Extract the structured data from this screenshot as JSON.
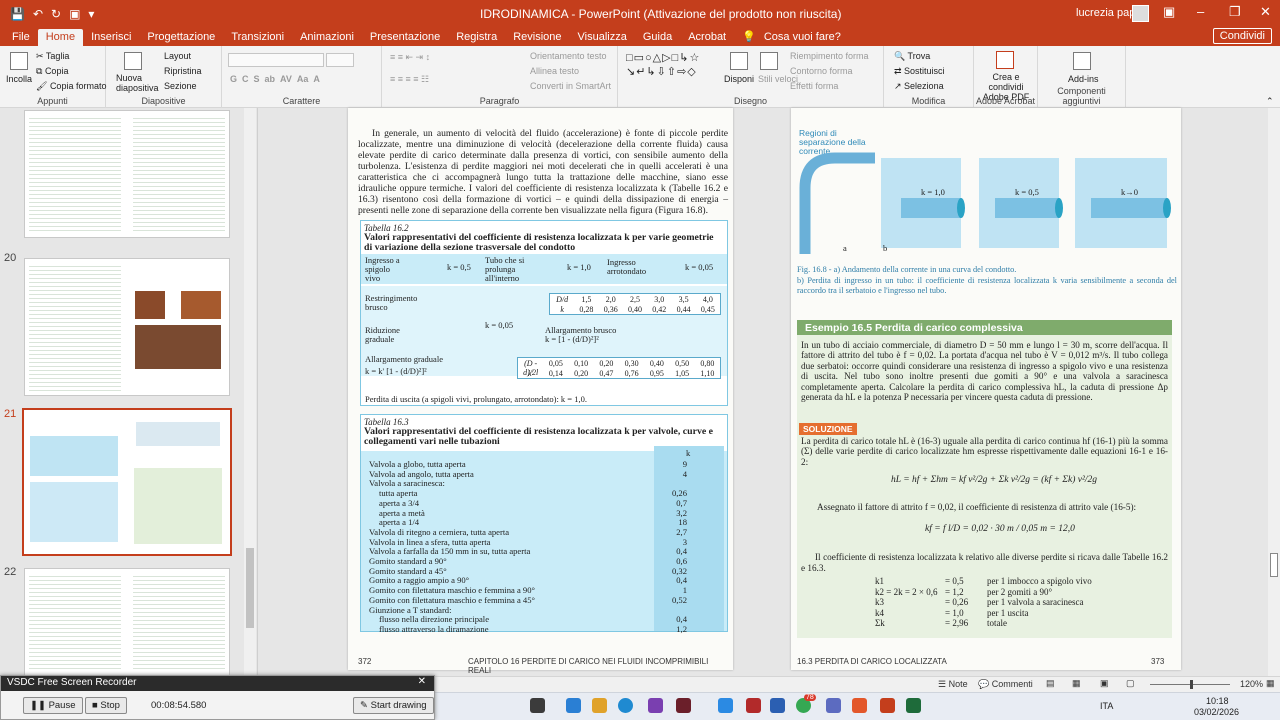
{
  "titlebar": {
    "title": "IDRODINAMICA  -  PowerPoint (Attivazione del prodotto non riuscita)",
    "user": "lucrezia papini"
  },
  "menu": {
    "tabs": [
      "File",
      "Home",
      "Inserisci",
      "Progettazione",
      "Transizioni",
      "Animazioni",
      "Presentazione",
      "Registra",
      "Revisione",
      "Visualizza",
      "Guida",
      "Acrobat"
    ],
    "active": "Home",
    "tell": "Cosa vuoi fare?",
    "share": "Condividi"
  },
  "ribbon": {
    "appunti": {
      "paste": "Incolla",
      "cut": "Taglia",
      "copy": "Copia",
      "format": "Copia formato",
      "label": "Appunti"
    },
    "diapositive": {
      "new": "Nuova diapositiva",
      "layout": "Layout",
      "reset": "Ripristina",
      "section": "Sezione",
      "label": "Diapositive"
    },
    "carattere": {
      "label": "Carattere"
    },
    "paragrafo": {
      "direction": "Orientamento testo",
      "align": "Allinea testo",
      "smartart": "Converti in SmartArt",
      "label": "Paragrafo"
    },
    "disegno": {
      "arrange": "Disponi",
      "quick": "Stili veloci",
      "fill": "Riempimento forma",
      "outline": "Contorno forma",
      "effects": "Effetti forma",
      "label": "Disegno"
    },
    "modifica": {
      "find": "Trova",
      "replace": "Sostituisci",
      "select": "Seleziona",
      "label": "Modifica"
    },
    "acrobat": {
      "create": "Crea e condividi Adobe PDF",
      "label": "Adobe Acrobat"
    },
    "addins": {
      "btn": "Add-ins",
      "label": "Componenti aggiuntivi"
    }
  },
  "slides": {
    "numbers": [
      "20",
      "21",
      "22"
    ],
    "selected": "21"
  },
  "left_page": {
    "para": "In generale, un aumento di velocità del fluido (accelerazione) è fonte di piccole perdite localizzate, mentre una diminuzione di velocità (decelerazione della corrente fluida) causa elevate perdite di carico determinate dalla presenza di vortici, con sensibile aumento della turbolenza. L'esistenza di perdite maggiori nei moti decelerati che in quelli accelerati è una caratteristica che ci accompagnerà lungo tutta la trattazione delle macchine, siano esse idrauliche oppure termiche. I valori del coefficiente di resistenza localizzata k (Tabelle 16.2 e 16.3) risentono così della formazione di vortici – e quindi della dissipazione di energia – presenti nelle zone di separazione della corrente ben visualizzate nella figura (Figura 16.8).",
    "t162": {
      "cap": "Tabella 16.2",
      "title": "Valori rappresentativi del coefficiente di resistenza localizzata k per varie geometrie di variazione della sezione trasversale del condotto",
      "c1": "Ingresso a spigolo vivo",
      "k1": "k = 0,5",
      "c2": "Tubo che si prolunga all'interno",
      "k2": "k = 1,0",
      "c3": "Ingresso arrotondato",
      "k3": "k = 0,05",
      "c4": "Restringimento brusco",
      "c5": "Riduzione graduale",
      "k5": "k = 0,05",
      "c6": "Allargamento brusco",
      "k6": "k = [1 - (d/D)²]²",
      "c7": "Allargamento graduale",
      "k7": "k = k' [1 - (d/D)²]²",
      "dd_head": "D/d",
      "dd_vals": [
        "1,5",
        "2,0",
        "2,5",
        "3,0",
        "3,5",
        "4,0"
      ],
      "dk_head": "k",
      "dk_vals": [
        "0,28",
        "0,36",
        "0,40",
        "0,42",
        "0,44",
        "0,45"
      ],
      "ang_head": "(D - d)/2l",
      "ang_vals": [
        "0,05",
        "0,10",
        "0,20",
        "0,30",
        "0,40",
        "0,50",
        "0,80"
      ],
      "kp_head": "k'",
      "kp_vals": [
        "0,14",
        "0,20",
        "0,47",
        "0,76",
        "0,95",
        "1,05",
        "1,10"
      ],
      "foot": "Perdita di uscita (a spigoli vivi, prolungato, arrotondato): k = 1,0."
    },
    "t163": {
      "cap": "Tabella 16.3",
      "title": "Valori rappresentativi del coefficiente di resistenza localizzata k per valvole, curve e collegamenti vari nelle tubazioni",
      "khead": "k",
      "rows": [
        [
          "Valvola a globo, tutta aperta",
          "9"
        ],
        [
          "Valvola ad angolo, tutta aperta",
          "4"
        ],
        [
          "Valvola a saracinesca:",
          ""
        ],
        [
          "  tutta aperta",
          "0,26"
        ],
        [
          "  aperta a 3/4",
          "0,7"
        ],
        [
          "  aperta a metà",
          "3,2"
        ],
        [
          "  aperta a 1/4",
          "18"
        ],
        [
          "Valvola di ritegno a cerniera, tutta aperta",
          "2,7"
        ],
        [
          "Valvola in linea a sfera, tutta aperta",
          "3"
        ],
        [
          "Valvola a farfalla da 150 mm in su, tutta aperta",
          "0,4"
        ],
        [
          "Gomito standard a 90°",
          "0,6"
        ],
        [
          "Gomito standard a 45°",
          "0,32"
        ],
        [
          "Gomito a raggio ampio a 90°",
          "0,4"
        ],
        [
          "Gomito con filettatura maschio e femmina a 90°",
          "1"
        ],
        [
          "Gomito con filettatura maschio e femmina a 45°",
          "0,52"
        ],
        [
          "Giunzione a T standard:",
          ""
        ],
        [
          "  flusso nella direzione principale",
          "0,4"
        ],
        [
          "  flusso attraverso la diramazione",
          "1,2"
        ]
      ]
    },
    "page_num": "372",
    "footer": "CAPITOLO 16   PERDITE DI CARICO NEI FLUIDI INCOMPRIMIBILI REALI"
  },
  "right_page": {
    "fig_label1": "Regioni di separazione della corrente",
    "fig_k": [
      "k = 1,0",
      "k = 0,5",
      "k→0"
    ],
    "fig_ab": [
      "a",
      "b"
    ],
    "fig_cap1": "Fig. 16.8 - a) Andamento della corrente in una curva del condotto.",
    "fig_cap2": "b) Perdita di ingresso in un tubo: il coefficiente di resistenza localizzata k varia sensibilmente a seconda del raccordo tra il serbatoio e l'ingresso nel tubo.",
    "ex_title": "Esempio 16.5   Perdita di carico complessiva",
    "ex_text": "In un tubo di acciaio commerciale, di diametro D = 50 mm e lungo l = 30 m, scorre dell'acqua. Il fattore di attrito del tubo è f = 0,02. La portata d'acqua nel tubo è V = 0,012 m³/s. Il tubo collega due serbatoi: occorre quindi considerare una resistenza di ingresso a spigolo vivo e una resistenza di uscita. Nel tubo sono inoltre presenti due gomiti a 90° e una valvola a saracinesca completamente aperta. Calcolare la perdita di carico complessiva hL, la caduta di pressione Δp generata da hL e la potenza P necessaria per vincere questa caduta di pressione.",
    "sol": "SOLUZIONE",
    "sol_text": "La perdita di carico totale hL è (16-3) uguale alla perdita di carico continua hf (16-1) più la somma (Σ) delle varie perdite di carico localizzate hm espresse rispettivamente dalle equazioni 16-1 e 16-2:",
    "eq1": "hL = hf + Σhm = kf v²/2g + Σk v²/2g = (kf + Σk) v²/2g",
    "assign": "Assegnato il fattore di attrito f = 0,02, il coefficiente di resistenza di attrito vale (16-5):",
    "eq2": "kf = f l/D = 0,02 · 30 m / 0,05 m = 12,0",
    "coef_text": "Il coefficiente di resistenza localizzata k relativo alle diverse perdite si ricava dalle Tabelle 16.2 e 16.3.",
    "klines": [
      [
        "k1",
        "= 0,5",
        "per 1 imbocco a spigolo vivo"
      ],
      [
        "k2 = 2k = 2 × 0,6",
        "= 1,2",
        "per 2 gomiti a 90°"
      ],
      [
        "k3",
        "= 0,26",
        "per 1 valvola a saracinesca"
      ],
      [
        "k4",
        "= 1,0",
        "per 1 uscita"
      ],
      [
        "Σk",
        "= 2,96",
        "totale"
      ]
    ],
    "footer": "16.3   PERDITA DI CARICO LOCALIZZATA",
    "page_num": "373"
  },
  "status": {
    "notes": "Note",
    "comments": "Commenti",
    "zoom": "120%"
  },
  "recorder": {
    "title": "VSDC Free Screen Recorder",
    "pause": "Pause",
    "stop": "Stop",
    "time": "00:08:54.580",
    "draw": "Start drawing"
  },
  "taskbar": {
    "time": "10:18",
    "date": "03/02/2026",
    "lang": "ITA",
    "badge": "78"
  }
}
